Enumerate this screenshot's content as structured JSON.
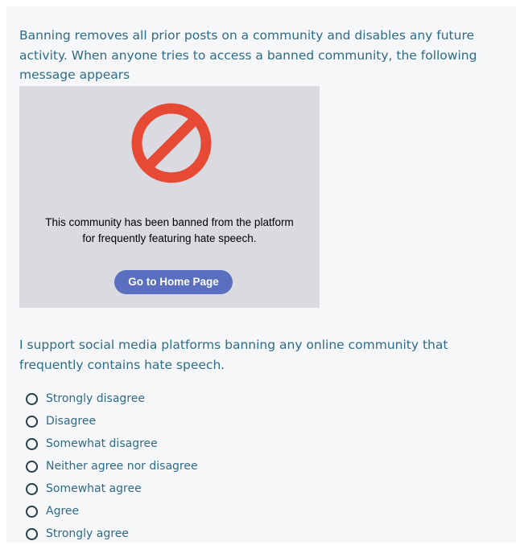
{
  "intro": {
    "text": "Banning removes all prior posts on a community and disables any future activity. When anyone tries to access a banned community, the following message appears"
  },
  "banner": {
    "icon": "prohibited-icon",
    "icon_color": "#e64a35",
    "message_line1": "This community has been banned from the platform",
    "message_line2": "for frequently featuring hate speech.",
    "button_label": "Go to Home Page",
    "button_color": "#5a6fc0"
  },
  "question": {
    "text": "I support social media platforms banning any online community that frequently contains hate speech."
  },
  "options": [
    {
      "label": "Strongly disagree"
    },
    {
      "label": "Disagree"
    },
    {
      "label": "Somewhat disagree"
    },
    {
      "label": "Neither agree nor disagree"
    },
    {
      "label": "Somewhat agree"
    },
    {
      "label": "Agree"
    },
    {
      "label": "Strongly agree"
    }
  ]
}
